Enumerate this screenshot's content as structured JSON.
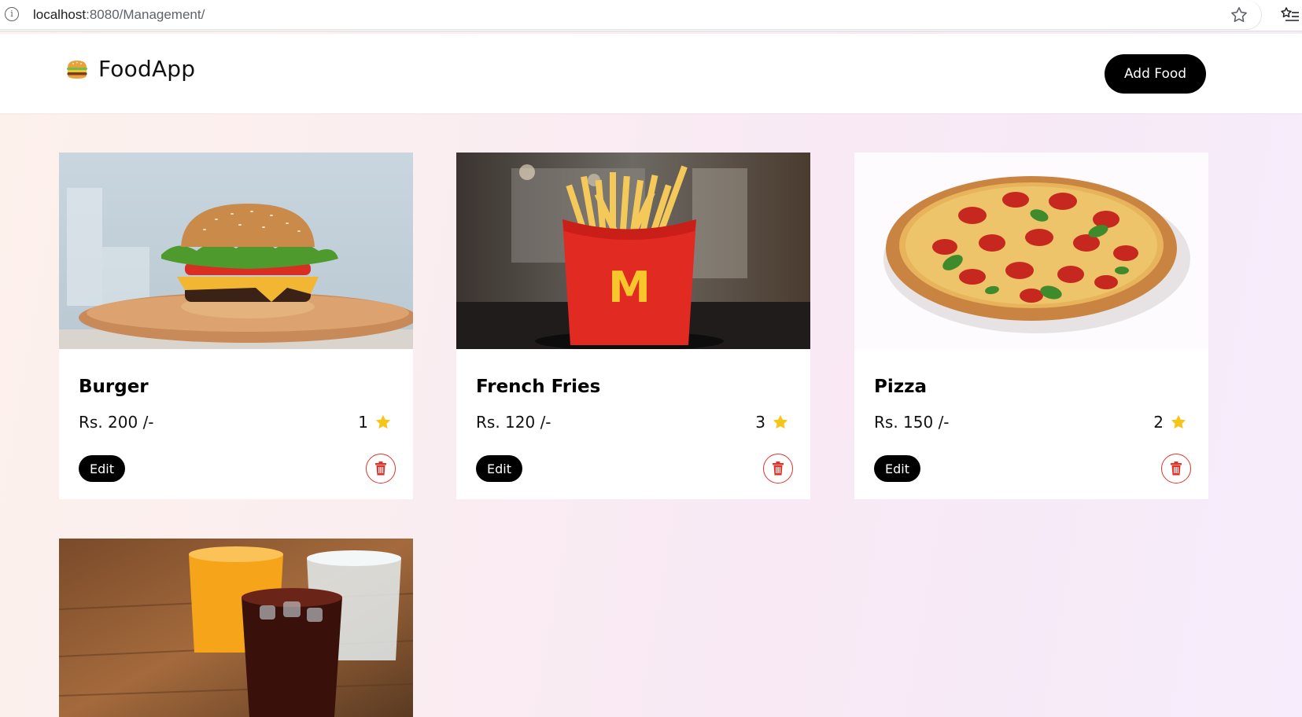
{
  "browser": {
    "url_host": "localhost",
    "url_path": ":8080/Management/"
  },
  "navbar": {
    "brand_name": "FoodApp",
    "add_food_label": "Add Food"
  },
  "foods": [
    {
      "name": "Burger",
      "price": "Rs. 200 /-",
      "rating": "1",
      "edit_label": "Edit"
    },
    {
      "name": "French Fries",
      "price": "Rs. 120 /-",
      "rating": "3",
      "edit_label": "Edit"
    },
    {
      "name": "Pizza",
      "price": "Rs. 150 /-",
      "rating": "2",
      "edit_label": "Edit"
    },
    {
      "name": "",
      "price": "",
      "rating": "",
      "edit_label": ""
    }
  ],
  "colors": {
    "accent": "#000000",
    "delete": "#e0342b",
    "star": "#f5c518"
  },
  "icons": {
    "info": "info-icon",
    "bookmark": "star-outline-icon",
    "reading_list": "reading-list-icon",
    "brand": "burger-icon",
    "rating": "star-icon",
    "delete": "trash-icon"
  }
}
